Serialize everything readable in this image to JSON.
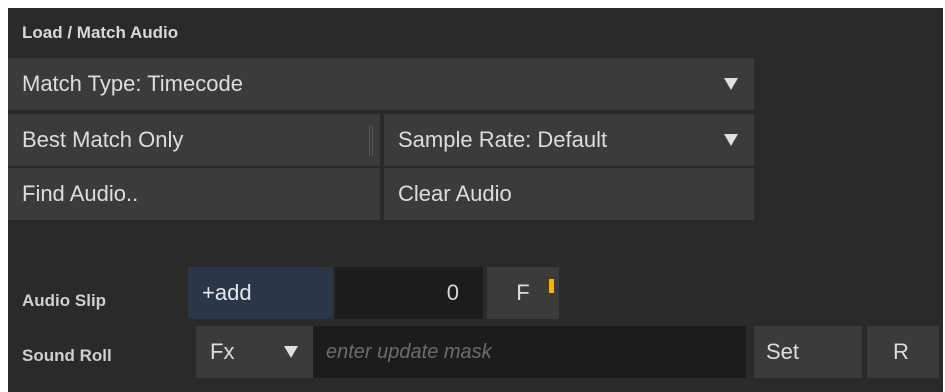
{
  "panel": {
    "title": "Load / Match Audio",
    "match_type": "Match Type: Timecode",
    "best_match": "Best Match Only",
    "sample_rate": "Sample Rate: Default",
    "find_audio": "Find Audio..",
    "clear_audio": "Clear Audio"
  },
  "audio_slip": {
    "label": "Audio Slip",
    "add_label": "+add",
    "value": "0",
    "unit_button": "F"
  },
  "sound_roll": {
    "label": "Sound Roll",
    "mode": "Fx",
    "mask_placeholder": "enter update mask",
    "set_button": "Set",
    "reset_button": "R"
  },
  "icons": {
    "dropdown": "chevron-down-icon",
    "marker": "keyframe-marker-icon"
  },
  "colors": {
    "panel_bg": "#2a2a2a",
    "button_bg": "#3b3b3b",
    "field_dark": "#1c1c1c",
    "add_field": "#283848",
    "marker": "#f4b400"
  }
}
